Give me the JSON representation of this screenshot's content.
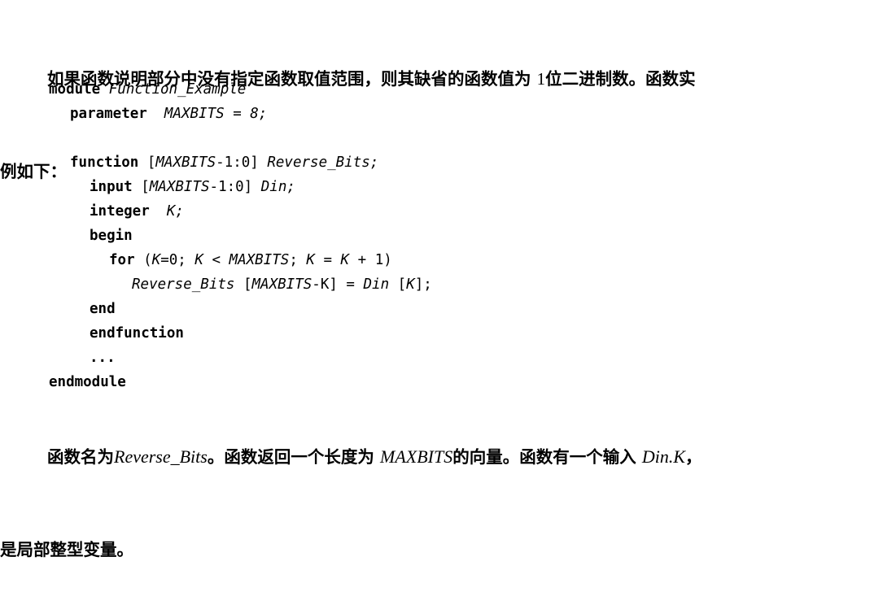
{
  "document": {
    "language": "zh-CN",
    "background_color": "#ffffff",
    "text_color": "#000000"
  },
  "intro_paragraph": {
    "line1": "如果函数说明部分中没有指定函数取值范围，则其缺省的函数值为 ",
    "number": "1",
    "line1_tail": "位二进制数。函数实",
    "line2": "例如下："
  },
  "code": {
    "language": "Verilog",
    "lines": [
      {
        "id": "line-module",
        "indent": 60,
        "tokens": [
          {
            "type": "keyword",
            "text": "module"
          },
          {
            "type": "plain",
            "text": " "
          },
          {
            "type": "identifier",
            "text": "Function_Example"
          }
        ]
      },
      {
        "id": "line-parameter",
        "indent": 86,
        "tokens": [
          {
            "type": "keyword",
            "text": "parameter"
          },
          {
            "type": "plain",
            "text": "  "
          },
          {
            "type": "identifier",
            "text": "MAXBITS = "
          },
          {
            "type": "identifier",
            "text": "8;"
          }
        ]
      },
      {
        "id": "line-blank-1",
        "indent": 0,
        "tokens": []
      },
      {
        "id": "line-function",
        "indent": 86,
        "tokens": [
          {
            "type": "keyword",
            "text": "function"
          },
          {
            "type": "plain",
            "text": " ["
          },
          {
            "type": "identifier",
            "text": "MAXBITS"
          },
          {
            "type": "plain",
            "text": "-1:0] "
          },
          {
            "type": "identifier",
            "text": "Reverse_Bits;"
          }
        ]
      },
      {
        "id": "line-input",
        "indent": 110,
        "tokens": [
          {
            "type": "keyword",
            "text": "input"
          },
          {
            "type": "plain",
            "text": " ["
          },
          {
            "type": "identifier",
            "text": "MAXBITS"
          },
          {
            "type": "plain",
            "text": "-1:0] "
          },
          {
            "type": "identifier",
            "text": "Din;"
          }
        ]
      },
      {
        "id": "line-integer",
        "indent": 110,
        "tokens": [
          {
            "type": "keyword",
            "text": "integer"
          },
          {
            "type": "plain",
            "text": "  "
          },
          {
            "type": "identifier",
            "text": "K;"
          }
        ]
      },
      {
        "id": "line-begin",
        "indent": 110,
        "tokens": [
          {
            "type": "keyword",
            "text": "begin"
          }
        ]
      },
      {
        "id": "line-for",
        "indent": 134,
        "tokens": [
          {
            "type": "keyword",
            "text": "for"
          },
          {
            "type": "plain",
            "text": " ("
          },
          {
            "type": "identifier",
            "text": "K"
          },
          {
            "type": "plain",
            "text": "=0; "
          },
          {
            "type": "identifier",
            "text": "K"
          },
          {
            "type": "plain",
            "text": " < "
          },
          {
            "type": "identifier",
            "text": "MAXBITS"
          },
          {
            "type": "plain",
            "text": "; "
          },
          {
            "type": "identifier",
            "text": "K"
          },
          {
            "type": "plain",
            "text": " = "
          },
          {
            "type": "identifier",
            "text": "K"
          },
          {
            "type": "plain",
            "text": " + 1)"
          }
        ]
      },
      {
        "id": "line-assign",
        "indent": 162,
        "tokens": [
          {
            "type": "identifier",
            "text": "Reverse_Bits"
          },
          {
            "type": "plain",
            "text": " ["
          },
          {
            "type": "identifier",
            "text": "MAXBITS"
          },
          {
            "type": "plain",
            "text": "-K] = "
          },
          {
            "type": "identifier",
            "text": "Din"
          },
          {
            "type": "plain",
            "text": " ["
          },
          {
            "type": "identifier",
            "text": "K"
          },
          {
            "type": "plain",
            "text": "];"
          }
        ]
      },
      {
        "id": "line-end",
        "indent": 110,
        "tokens": [
          {
            "type": "keyword",
            "text": "end"
          }
        ]
      },
      {
        "id": "line-endfunction",
        "indent": 110,
        "tokens": [
          {
            "type": "keyword",
            "text": "endfunction"
          }
        ]
      },
      {
        "id": "line-ellipsis",
        "indent": 110,
        "tokens": [
          {
            "type": "keyword",
            "text": "..."
          }
        ]
      },
      {
        "id": "line-endmodule",
        "indent": 60,
        "tokens": [
          {
            "type": "keyword",
            "text": "endmodule"
          }
        ]
      }
    ]
  },
  "closing_paragraph": {
    "seg1": "函数名为",
    "term1": "Reverse_Bits",
    "seg2": "。函数返回一个长度为 ",
    "term2": "MAXBITS",
    "seg3": "的向量。函数有一个输入 ",
    "term3": "Din.K",
    "seg4": "，",
    "line2": "是局部整型变量。"
  }
}
